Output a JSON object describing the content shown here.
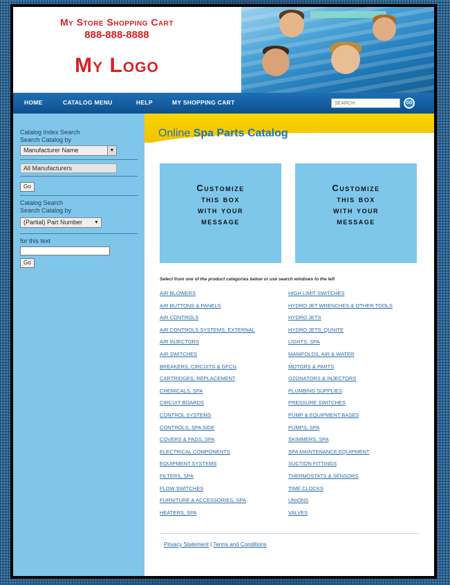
{
  "header": {
    "store_name": "My Store Shopping Cart",
    "phone": "888-888-8888",
    "logo": "My Logo"
  },
  "nav": {
    "items": [
      "HOME",
      "CATALOG MENU",
      "HELP",
      "MY SHOPPING CART"
    ],
    "search_placeholder": "SEARCH",
    "go_label": "GO"
  },
  "sidebar": {
    "index_search_label": "Catalog Index Search",
    "search_by_label": "Search Catalog by",
    "manufacturer_select": "Manufacturer Name",
    "all_manufacturers": "All Manufacturers",
    "go1": "Go",
    "catalog_search_label": "Catalog Search",
    "search_by_label2": "Search Catalog by",
    "part_select": "(Partial) Part Number",
    "for_text_label": "for this text",
    "go2": "Go"
  },
  "main": {
    "title_prefix": "Online ",
    "title_bold": "Spa Parts Catalog",
    "promo1": [
      "Customize",
      "this box",
      "with your",
      "message"
    ],
    "promo2": [
      "Customize",
      "this box",
      "with your",
      "message"
    ],
    "instruction": "Select from one of the product categories below or use search windows to the left",
    "categories_left": [
      "AIR BLOWERS",
      "AIR BUTTONS & PANELS",
      "AIR CONTROLS",
      "AIR CONTROLS SYSTEMS, EXTERNAL",
      "AIR INJECTORS",
      "AIR SWITCHES",
      "BREAKERS, CIRCUITS & GFCIs",
      "CARTRIDGES, REPLACEMENT",
      "CHEMICALS, SPA",
      "CIRCUIT BOARDS",
      "CONTROL SYSTEMS",
      "CONTROLS, SPA SIDE",
      "COVERS & PADS, SPA",
      "ELECTRICAL COMPONENTS",
      "EQUIPMENT SYSTEMS",
      "FILTERS, SPA",
      "FLOW SWITCHES",
      "FURNITURE & ACCESSORIES, SPA",
      "HEATERS, SPA"
    ],
    "categories_right": [
      "HIGH LIMIT SWITCHES",
      "HYDRO JET WRENCHES & OTHER TOOLS",
      "HYDRO JETS",
      "HYDRO JETS, QUNITE",
      "LIGHTS, SPA",
      "MANIFOLDS, AIR & WATER",
      "MOTORS & PARTS",
      "OZONATORS & INJECTORS",
      "PLUMBING SUPPLIES",
      "PRESSURE SWITCHES",
      "PUMP & EQUIPMENT BASES",
      "PUMPS, SPA",
      "SKIMMERS, SPA",
      "SPA MAINTENANCE EQUIPMENT",
      "SUCTION FITTINGS",
      "THERMOSTATS & SENSORS",
      "TIME CLOCKS",
      "UNIONS",
      "VALVES"
    ],
    "footer_privacy": "Privacy Statement",
    "footer_sep": " | ",
    "footer_terms": "Terms and Conditions"
  }
}
